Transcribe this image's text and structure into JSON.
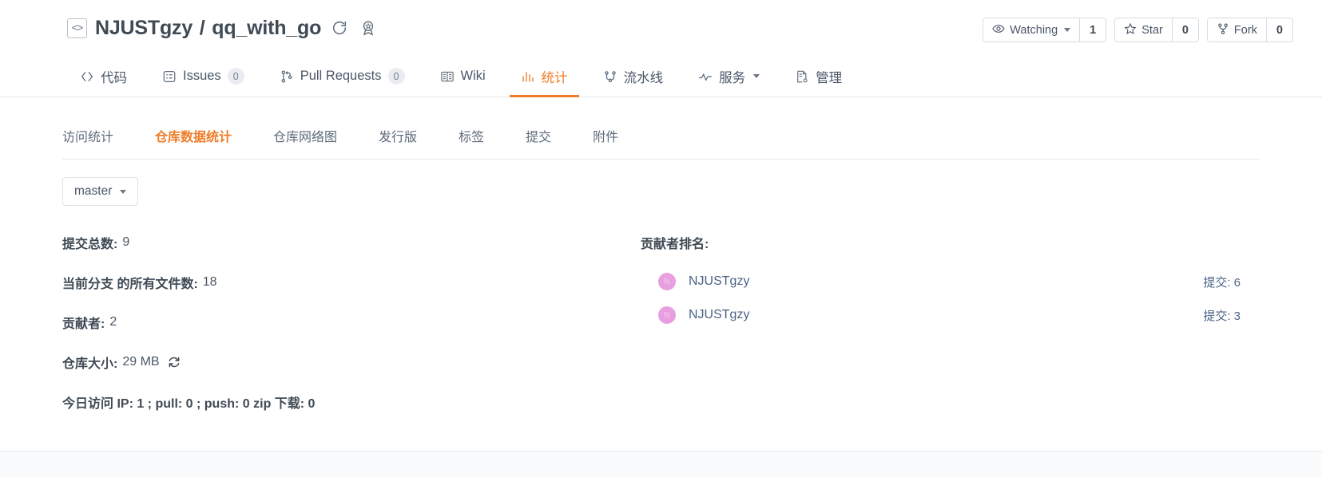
{
  "header": {
    "code_icon": "code-brackets-icon",
    "owner": "NJUSTgzy",
    "separator": "/",
    "repo": "qq_with_go",
    "fork_sync_icon": "sync-circle-icon",
    "badge_icon": "award-badge-icon",
    "actions": [
      {
        "icon": "eye-icon",
        "label": "Watching",
        "has_caret": true,
        "count": "1"
      },
      {
        "icon": "star-icon",
        "label": "Star",
        "has_caret": false,
        "count": "0"
      },
      {
        "icon": "fork-icon",
        "label": "Fork",
        "has_caret": false,
        "count": "0"
      }
    ]
  },
  "main_nav": [
    {
      "icon": "code-icon",
      "label": "代码",
      "badge": null,
      "active": false,
      "caret": false
    },
    {
      "icon": "issues-icon",
      "label": "Issues",
      "badge": "0",
      "active": false,
      "caret": false
    },
    {
      "icon": "pull-request-icon",
      "label": "Pull Requests",
      "badge": "0",
      "active": false,
      "caret": false
    },
    {
      "icon": "book-icon",
      "label": "Wiki",
      "badge": null,
      "active": false,
      "caret": false
    },
    {
      "icon": "chart-bar-icon",
      "label": "统计",
      "badge": null,
      "active": true,
      "caret": false
    },
    {
      "icon": "pipeline-icon",
      "label": "流水线",
      "badge": null,
      "active": false,
      "caret": false
    },
    {
      "icon": "activity-icon",
      "label": "服务",
      "badge": null,
      "active": false,
      "caret": true
    },
    {
      "icon": "settings-doc-icon",
      "label": "管理",
      "badge": null,
      "active": false,
      "caret": false
    }
  ],
  "sub_nav": [
    {
      "label": "访问统计",
      "active": false
    },
    {
      "label": "仓库数据统计",
      "active": true
    },
    {
      "label": "仓库网络图",
      "active": false
    },
    {
      "label": "发行版",
      "active": false
    },
    {
      "label": "标签",
      "active": false
    },
    {
      "label": "提交",
      "active": false
    },
    {
      "label": "附件",
      "active": false
    }
  ],
  "branch": {
    "label": "master",
    "caret_icon": "chevron-down-icon"
  },
  "stats": [
    {
      "key": "提交总数:",
      "value": "9",
      "refresh": false
    },
    {
      "key": "当前分支 的所有文件数:",
      "value": "18",
      "refresh": false
    },
    {
      "key": "贡献者:",
      "value": "2",
      "refresh": false
    },
    {
      "key": "仓库大小:",
      "value": "29 MB",
      "refresh": true
    },
    {
      "key": "今日访问 IP: 1 ; pull: 0 ; push: 0 zip 下载: 0",
      "value": "",
      "refresh": false
    }
  ],
  "contributors": {
    "title": "贡献者排名:",
    "rows": [
      {
        "avatar_initial": "N",
        "name": "NJUSTgzy",
        "commits": "提交: 6"
      },
      {
        "avatar_initial": "N",
        "name": "NJUSTgzy",
        "commits": "提交: 3"
      }
    ]
  },
  "colors": {
    "accent": "#f07c28",
    "text": "#3f4a54",
    "link": "#4a6285",
    "avatar": "#e89fe0",
    "border": "#e3e8ee"
  }
}
